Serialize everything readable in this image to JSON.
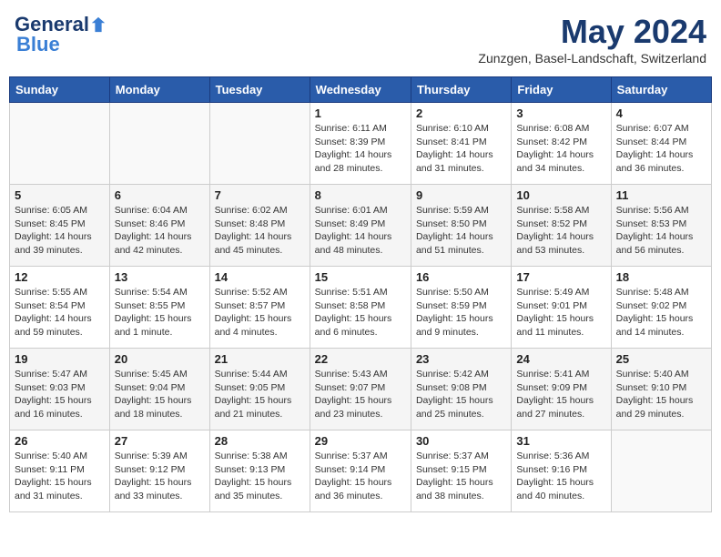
{
  "header": {
    "logo_general": "General",
    "logo_blue": "Blue",
    "month": "May 2024",
    "location": "Zunzgen, Basel-Landschaft, Switzerland"
  },
  "weekdays": [
    "Sunday",
    "Monday",
    "Tuesday",
    "Wednesday",
    "Thursday",
    "Friday",
    "Saturday"
  ],
  "weeks": [
    [
      {
        "day": "",
        "info": ""
      },
      {
        "day": "",
        "info": ""
      },
      {
        "day": "",
        "info": ""
      },
      {
        "day": "1",
        "info": "Sunrise: 6:11 AM\nSunset: 8:39 PM\nDaylight: 14 hours\nand 28 minutes."
      },
      {
        "day": "2",
        "info": "Sunrise: 6:10 AM\nSunset: 8:41 PM\nDaylight: 14 hours\nand 31 minutes."
      },
      {
        "day": "3",
        "info": "Sunrise: 6:08 AM\nSunset: 8:42 PM\nDaylight: 14 hours\nand 34 minutes."
      },
      {
        "day": "4",
        "info": "Sunrise: 6:07 AM\nSunset: 8:44 PM\nDaylight: 14 hours\nand 36 minutes."
      }
    ],
    [
      {
        "day": "5",
        "info": "Sunrise: 6:05 AM\nSunset: 8:45 PM\nDaylight: 14 hours\nand 39 minutes."
      },
      {
        "day": "6",
        "info": "Sunrise: 6:04 AM\nSunset: 8:46 PM\nDaylight: 14 hours\nand 42 minutes."
      },
      {
        "day": "7",
        "info": "Sunrise: 6:02 AM\nSunset: 8:48 PM\nDaylight: 14 hours\nand 45 minutes."
      },
      {
        "day": "8",
        "info": "Sunrise: 6:01 AM\nSunset: 8:49 PM\nDaylight: 14 hours\nand 48 minutes."
      },
      {
        "day": "9",
        "info": "Sunrise: 5:59 AM\nSunset: 8:50 PM\nDaylight: 14 hours\nand 51 minutes."
      },
      {
        "day": "10",
        "info": "Sunrise: 5:58 AM\nSunset: 8:52 PM\nDaylight: 14 hours\nand 53 minutes."
      },
      {
        "day": "11",
        "info": "Sunrise: 5:56 AM\nSunset: 8:53 PM\nDaylight: 14 hours\nand 56 minutes."
      }
    ],
    [
      {
        "day": "12",
        "info": "Sunrise: 5:55 AM\nSunset: 8:54 PM\nDaylight: 14 hours\nand 59 minutes."
      },
      {
        "day": "13",
        "info": "Sunrise: 5:54 AM\nSunset: 8:55 PM\nDaylight: 15 hours\nand 1 minute."
      },
      {
        "day": "14",
        "info": "Sunrise: 5:52 AM\nSunset: 8:57 PM\nDaylight: 15 hours\nand 4 minutes."
      },
      {
        "day": "15",
        "info": "Sunrise: 5:51 AM\nSunset: 8:58 PM\nDaylight: 15 hours\nand 6 minutes."
      },
      {
        "day": "16",
        "info": "Sunrise: 5:50 AM\nSunset: 8:59 PM\nDaylight: 15 hours\nand 9 minutes."
      },
      {
        "day": "17",
        "info": "Sunrise: 5:49 AM\nSunset: 9:01 PM\nDaylight: 15 hours\nand 11 minutes."
      },
      {
        "day": "18",
        "info": "Sunrise: 5:48 AM\nSunset: 9:02 PM\nDaylight: 15 hours\nand 14 minutes."
      }
    ],
    [
      {
        "day": "19",
        "info": "Sunrise: 5:47 AM\nSunset: 9:03 PM\nDaylight: 15 hours\nand 16 minutes."
      },
      {
        "day": "20",
        "info": "Sunrise: 5:45 AM\nSunset: 9:04 PM\nDaylight: 15 hours\nand 18 minutes."
      },
      {
        "day": "21",
        "info": "Sunrise: 5:44 AM\nSunset: 9:05 PM\nDaylight: 15 hours\nand 21 minutes."
      },
      {
        "day": "22",
        "info": "Sunrise: 5:43 AM\nSunset: 9:07 PM\nDaylight: 15 hours\nand 23 minutes."
      },
      {
        "day": "23",
        "info": "Sunrise: 5:42 AM\nSunset: 9:08 PM\nDaylight: 15 hours\nand 25 minutes."
      },
      {
        "day": "24",
        "info": "Sunrise: 5:41 AM\nSunset: 9:09 PM\nDaylight: 15 hours\nand 27 minutes."
      },
      {
        "day": "25",
        "info": "Sunrise: 5:40 AM\nSunset: 9:10 PM\nDaylight: 15 hours\nand 29 minutes."
      }
    ],
    [
      {
        "day": "26",
        "info": "Sunrise: 5:40 AM\nSunset: 9:11 PM\nDaylight: 15 hours\nand 31 minutes."
      },
      {
        "day": "27",
        "info": "Sunrise: 5:39 AM\nSunset: 9:12 PM\nDaylight: 15 hours\nand 33 minutes."
      },
      {
        "day": "28",
        "info": "Sunrise: 5:38 AM\nSunset: 9:13 PM\nDaylight: 15 hours\nand 35 minutes."
      },
      {
        "day": "29",
        "info": "Sunrise: 5:37 AM\nSunset: 9:14 PM\nDaylight: 15 hours\nand 36 minutes."
      },
      {
        "day": "30",
        "info": "Sunrise: 5:37 AM\nSunset: 9:15 PM\nDaylight: 15 hours\nand 38 minutes."
      },
      {
        "day": "31",
        "info": "Sunrise: 5:36 AM\nSunset: 9:16 PM\nDaylight: 15 hours\nand 40 minutes."
      },
      {
        "day": "",
        "info": ""
      }
    ]
  ]
}
